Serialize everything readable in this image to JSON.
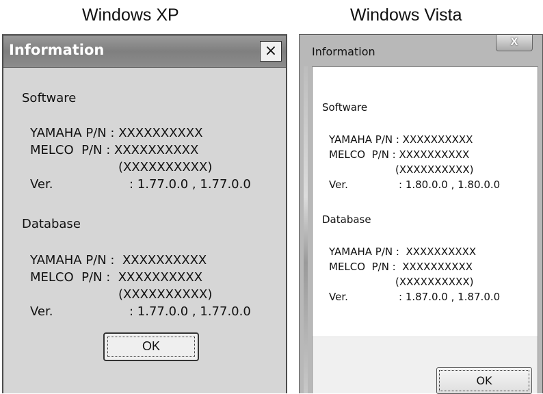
{
  "captions": {
    "xp": "Windows XP",
    "vista": "Windows Vista"
  },
  "xp": {
    "title": "Information",
    "close_glyph": "×",
    "software_heading": "Software",
    "software_lines": [
      "YAMAHA P/N : XXXXXXXXXX",
      "MELCO  P/N : XXXXXXXXXX",
      "(XXXXXXXXXX)"
    ],
    "software_ver_label": "Ver.",
    "software_ver_value": ": 1.77.0.0 , 1.77.0.0",
    "database_heading": "Database",
    "database_lines": [
      "YAMAHA P/N :  XXXXXXXXXX",
      "MELCO  P/N :  XXXXXXXXXX",
      "(XXXXXXXXXX)"
    ],
    "database_ver_label": "Ver.",
    "database_ver_value": ": 1.77.0.0 , 1.77.0.0",
    "ok_label": "OK"
  },
  "vista": {
    "title": "Information",
    "close_glyph": "X",
    "software_heading": "Software",
    "software_lines": [
      "YAMAHA P/N : XXXXXXXXXX",
      "MELCO  P/N : XXXXXXXXXX",
      "(XXXXXXXXXX)"
    ],
    "software_ver_label": "Ver.",
    "software_ver_value": ": 1.80.0.0 , 1.80.0.0",
    "database_heading": "Database",
    "database_lines": [
      "YAMAHA P/N :  XXXXXXXXXX",
      "MELCO  P/N :  XXXXXXXXXX",
      "(XXXXXXXXXX)"
    ],
    "database_ver_label": "Ver.",
    "database_ver_value": ": 1.87.0.0 , 1.87.0.0",
    "ok_label": "OK"
  }
}
